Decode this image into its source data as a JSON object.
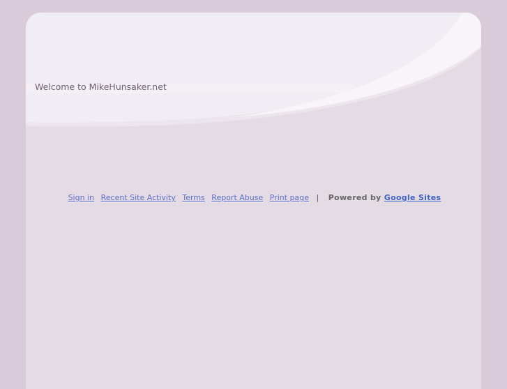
{
  "header": {
    "site_title": "Welcome to MikeHunsaker.net"
  },
  "footer": {
    "links": {
      "sign_in": "Sign in",
      "recent_activity": "Recent Site Activity",
      "terms": "Terms",
      "report_abuse": "Report Abuse",
      "print_page": "Print page"
    },
    "separator": "|",
    "powered_by": "Powered by",
    "google_sites": "Google Sites"
  },
  "colors": {
    "background": "#d9cbd9",
    "content": "#e4dbe5",
    "link": "#5b70c9"
  }
}
